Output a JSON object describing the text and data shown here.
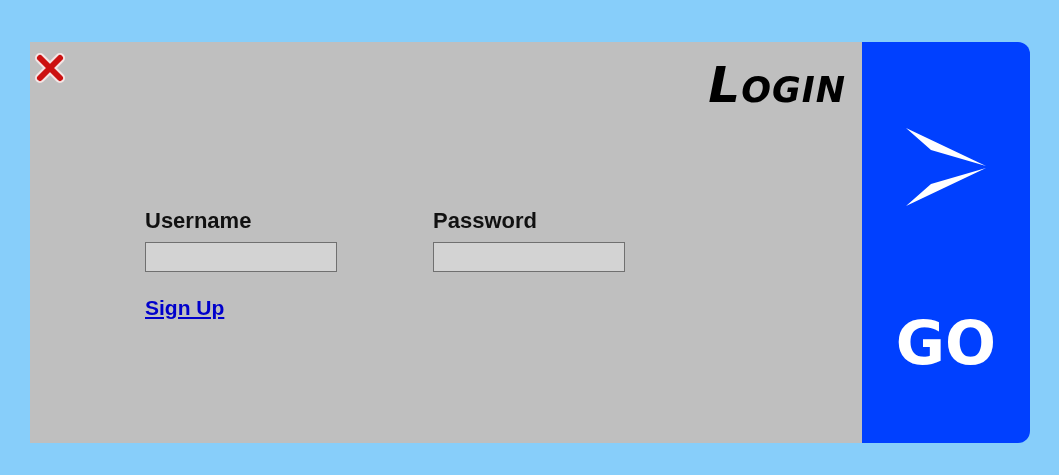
{
  "title": "Login",
  "fields": [
    {
      "label": "Username"
    },
    {
      "label": "Password"
    }
  ],
  "signup_link": "Sign Up",
  "go_button": {
    "label": "GO"
  }
}
